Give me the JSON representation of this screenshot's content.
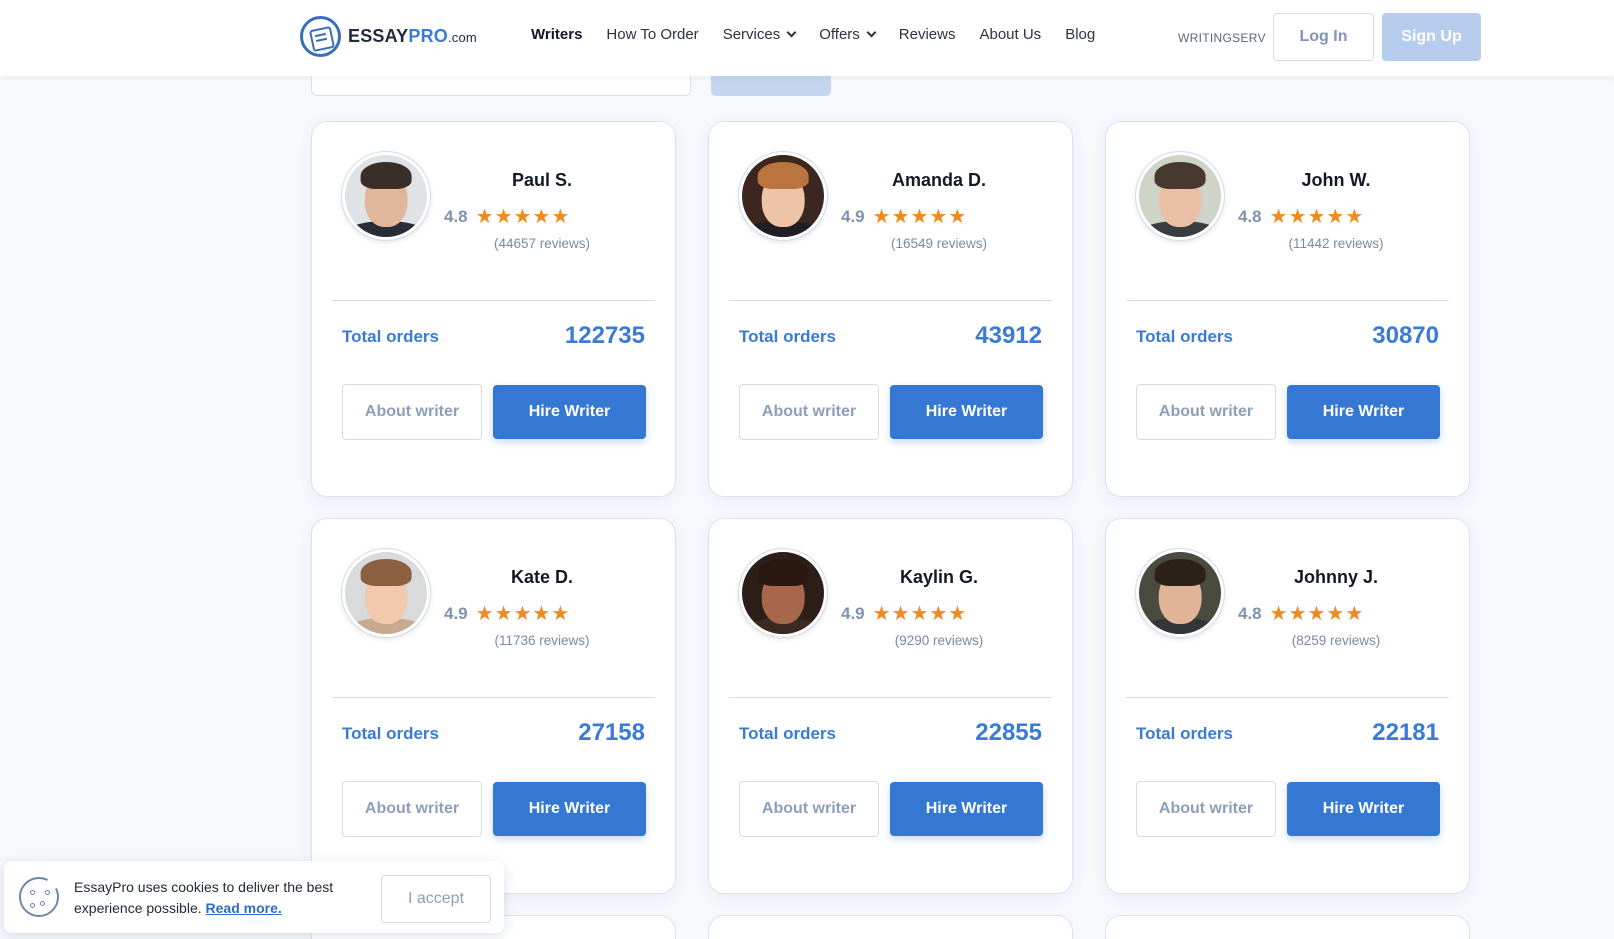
{
  "header": {
    "logo": {
      "part1": "ESSAY",
      "part2": "PRO",
      "part3": ".com"
    },
    "nav": [
      {
        "label": "Writers",
        "active": true
      },
      {
        "label": "How To Order"
      },
      {
        "label": "Services",
        "dropdown": true
      },
      {
        "label": "Offers",
        "dropdown": true
      },
      {
        "label": "Reviews"
      },
      {
        "label": "About Us"
      },
      {
        "label": "Blog"
      }
    ],
    "promo_code": "WRITINGSERV",
    "login_label": "Log In",
    "signup_label": "Sign Up"
  },
  "writers": [
    {
      "name": "Paul S.",
      "rating": "4.8",
      "reviews": "(44657 reviews)",
      "orders_label": "Total orders",
      "orders": "122735",
      "about_label": "About writer",
      "hire_label": "Hire Writer",
      "avatar": {
        "bg": "#dfe3e6",
        "skin": "#e1b79c",
        "hair": "#3a2e28",
        "shirt": "#2a2d33"
      }
    },
    {
      "name": "Amanda D.",
      "rating": "4.9",
      "reviews": "(16549 reviews)",
      "orders_label": "Total orders",
      "orders": "43912",
      "about_label": "About writer",
      "hire_label": "Hire Writer",
      "avatar": {
        "bg": "#3c2720",
        "skin": "#efc3a8",
        "hair": "#b9743f",
        "shirt": "#1f1e22"
      }
    },
    {
      "name": "John W.",
      "rating": "4.8",
      "reviews": "(11442 reviews)",
      "orders_label": "Total orders",
      "orders": "30870",
      "about_label": "About writer",
      "hire_label": "Hire Writer",
      "avatar": {
        "bg": "#cfd4c8",
        "skin": "#e9c0a6",
        "hair": "#47392f",
        "shirt": "#3a3c42"
      }
    },
    {
      "name": "Kate D.",
      "rating": "4.9",
      "reviews": "(11736 reviews)",
      "orders_label": "Total orders",
      "orders": "27158",
      "about_label": "About writer",
      "hire_label": "Hire Writer",
      "avatar": {
        "bg": "#d8dadb",
        "skin": "#f0c9ae",
        "hair": "#8a6040",
        "shirt": "#c9a98f"
      }
    },
    {
      "name": "Kaylin G.",
      "rating": "4.9",
      "reviews": "(9290 reviews)",
      "orders_label": "Total orders",
      "orders": "22855",
      "about_label": "About writer",
      "hire_label": "Hire Writer",
      "avatar": {
        "bg": "#2e1e18",
        "skin": "#a7674a",
        "hair": "#2a1810",
        "shirt": "#3b2a24"
      }
    },
    {
      "name": "Johnny J.",
      "rating": "4.8",
      "reviews": "(8259 reviews)",
      "orders_label": "Total orders",
      "orders": "22181",
      "about_label": "About writer",
      "hire_label": "Hire Writer",
      "avatar": {
        "bg": "#4a4a3e",
        "skin": "#e2b497",
        "hair": "#2d2219",
        "shirt": "#333538"
      }
    }
  ],
  "rating_stars": "★★★★★",
  "cookie": {
    "text": "EssayPro uses cookies to deliver the best experience possible.",
    "link": "Read more.",
    "accept_label": "I accept"
  },
  "colors": {
    "accent": "#3478d3",
    "star": "#f08a1c",
    "signup": "#b6cdee"
  }
}
